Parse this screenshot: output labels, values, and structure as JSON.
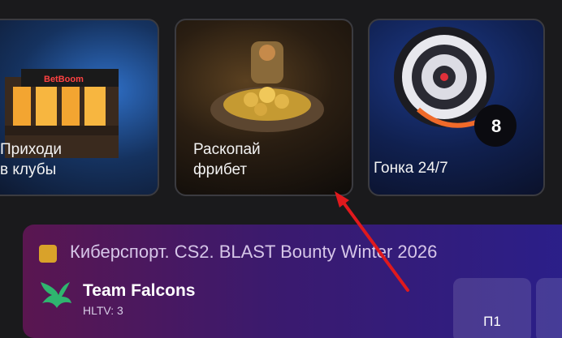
{
  "promos": [
    {
      "label": "Приходи\nв клубы",
      "sign": "BetBoom"
    },
    {
      "label": "Раскопай\nфрибет"
    },
    {
      "label": "Гонка 24/7",
      "ball": "8"
    }
  ],
  "match": {
    "league": "Киберспорт. CS2. BLAST Bounty Winter 2026",
    "team": "Team Falcons",
    "rank": "HLTV: 3",
    "odds_label": "П1"
  },
  "colors": {
    "accent_arrow": "#e0191d",
    "league_icon": "#d9a22a"
  }
}
